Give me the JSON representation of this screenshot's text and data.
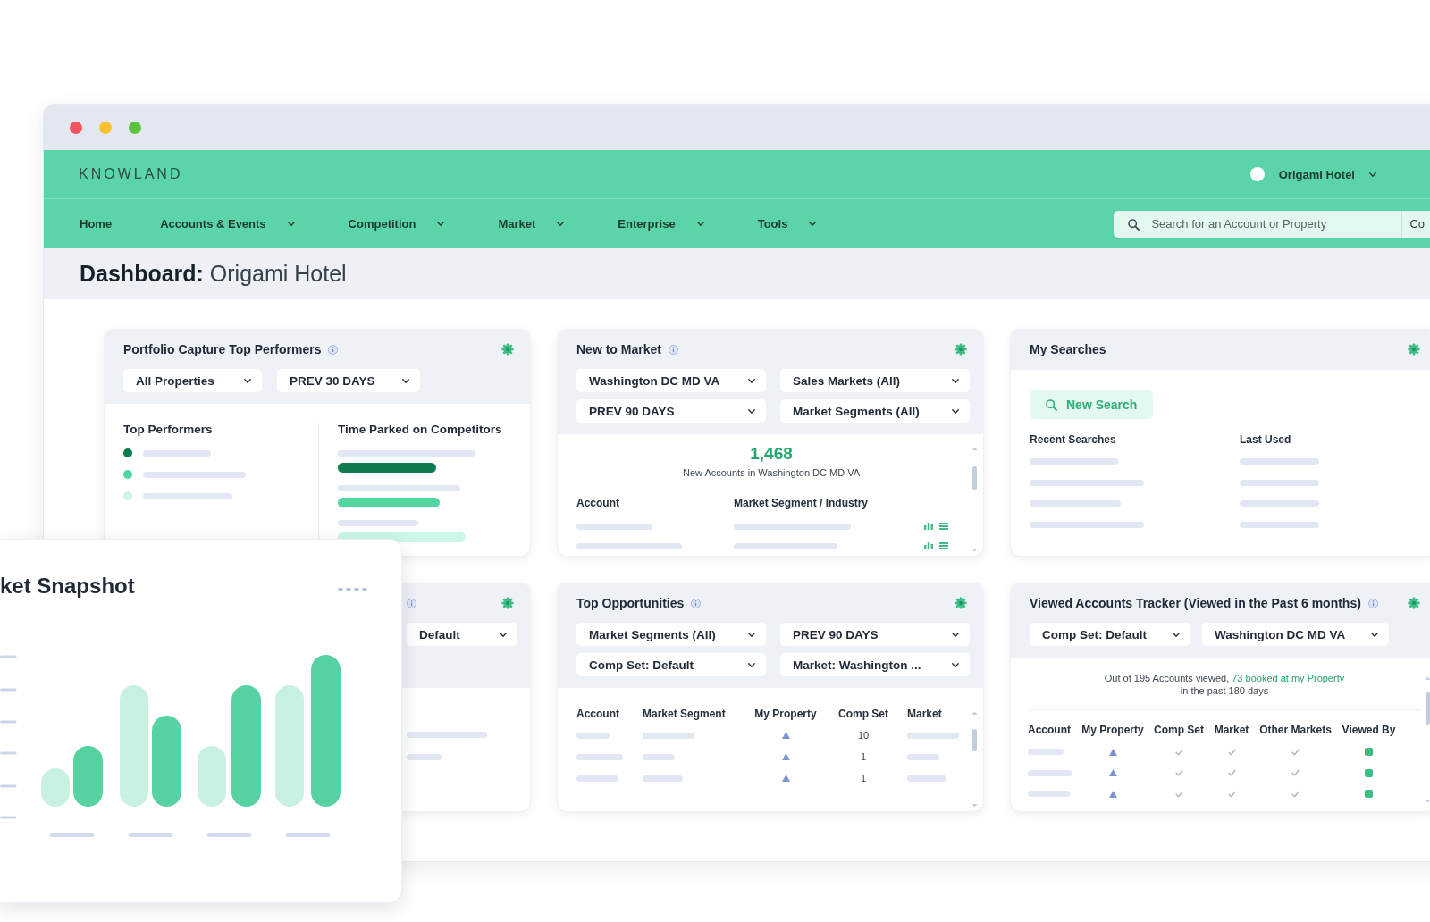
{
  "header": {
    "logo": "KNOWLAND",
    "user_menu": {
      "label": "Origami Hotel"
    },
    "nav": [
      {
        "label": "Home",
        "menu": false
      },
      {
        "label": "Accounts & Events",
        "menu": true
      },
      {
        "label": "Competition",
        "menu": true
      },
      {
        "label": "Market",
        "menu": true
      },
      {
        "label": "Enterprise",
        "menu": true
      },
      {
        "label": "Tools",
        "menu": true
      }
    ],
    "search": {
      "placeholder": "Search for an Account or Property",
      "scope": "Co"
    }
  },
  "page_title": "**Dashboard:** Origami Hotel",
  "widgets": [
    {
      "kind": "portfolio",
      "title": "Portfolio Capture Top Performers",
      "filters": [
        "All Properties",
        "PREV 30 DAYS"
      ],
      "performers_heading": "Top Performers",
      "performers": [
        {
          "color": "#0e7a4d"
        },
        {
          "color": "#52d6a0"
        },
        {
          "color": "#ccf7e6"
        }
      ],
      "time_heading": "Time Parked on Competitors",
      "time_bars": [
        {
          "color": "#0e7a4d"
        },
        {
          "color": "#52d6a0"
        },
        {
          "color": "#ccf7e6"
        }
      ]
    },
    {
      "kind": "new_to_market",
      "title": "New to Market",
      "filters": [
        "Washington DC MD VA",
        "Sales Markets (All)",
        "PREV 90 DAYS",
        "Market Segments (All)"
      ],
      "total": "1,468",
      "total_caption": "New Accounts in Washington DC MD VA",
      "columns": [
        "Account",
        "Market Segment / Industry"
      ]
    },
    {
      "kind": "searches",
      "title": "My Searches",
      "button": "New Search",
      "columns": [
        "Recent Searches",
        "Last Used"
      ]
    },
    {
      "kind": "covered",
      "filters": [
        "Default"
      ]
    },
    {
      "kind": "opportunities",
      "title": "Top Opportunities",
      "filters": [
        "Market Segments (All)",
        "PREV 90 DAYS",
        "Comp Set: Default",
        "Market: Washington ..."
      ],
      "columns": [
        "Account",
        "Market Segment",
        "My Property",
        "Comp Set",
        "Market"
      ],
      "rows": [
        {
          "comp_set": "10"
        },
        {
          "comp_set": "1"
        },
        {
          "comp_set": "1"
        }
      ]
    },
    {
      "kind": "viewed",
      "title": "Viewed Accounts Tracker (Viewed in the Past 6 months)",
      "filters": [
        "Comp Set: Default",
        "Washington DC MD VA"
      ],
      "summary": {
        "text": "Out of 195 Accounts viewed,",
        "link": "73 booked at my Property",
        "text_after": "in the past 180 days"
      },
      "columns": [
        "Account",
        "My Property",
        "Comp Set",
        "Market",
        "Other Markets",
        "Viewed By"
      ],
      "rows": [
        {
          "comp_set": true,
          "market": true,
          "other_markets": true
        },
        {
          "comp_set": true,
          "market": true,
          "other_markets": true
        },
        {
          "comp_set": true,
          "market": true,
          "other_markets": true
        }
      ]
    }
  ],
  "snapshot": {
    "title": "ket Snapshot"
  }
}
